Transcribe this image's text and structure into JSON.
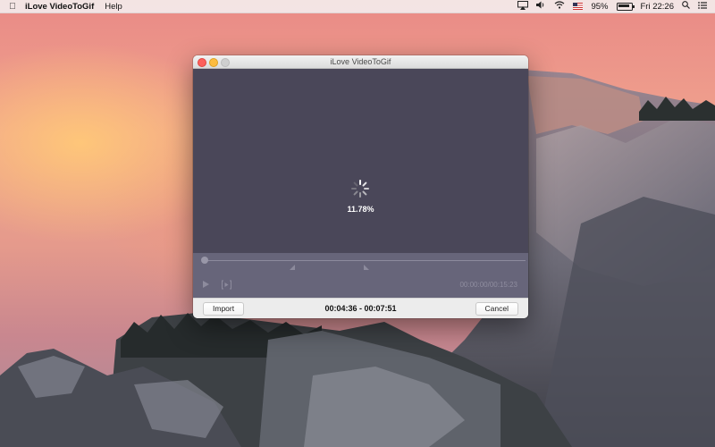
{
  "menubar": {
    "app_name": "iLove VideoToGif",
    "menus": [
      "Help"
    ],
    "battery": "95%",
    "clock": "Fri 22:26",
    "icons": [
      "apple-icon",
      "airplay-icon",
      "volume-icon",
      "wifi-icon",
      "us-flag-icon",
      "battery-icon",
      "spotlight-icon",
      "notification-center-icon"
    ]
  },
  "window": {
    "title": "iLove VideoToGif",
    "progress_text": "11.78%",
    "timecode": "00:00:00/00:15:23",
    "range_text": "00:04:36 - 00:07:51",
    "import_label": "Import",
    "cancel_label": "Cancel"
  },
  "colors": {
    "preview_bg": "#4a4759",
    "timeline_bg": "#67657a",
    "close": "#fc605c",
    "minimize": "#fdbc40"
  }
}
